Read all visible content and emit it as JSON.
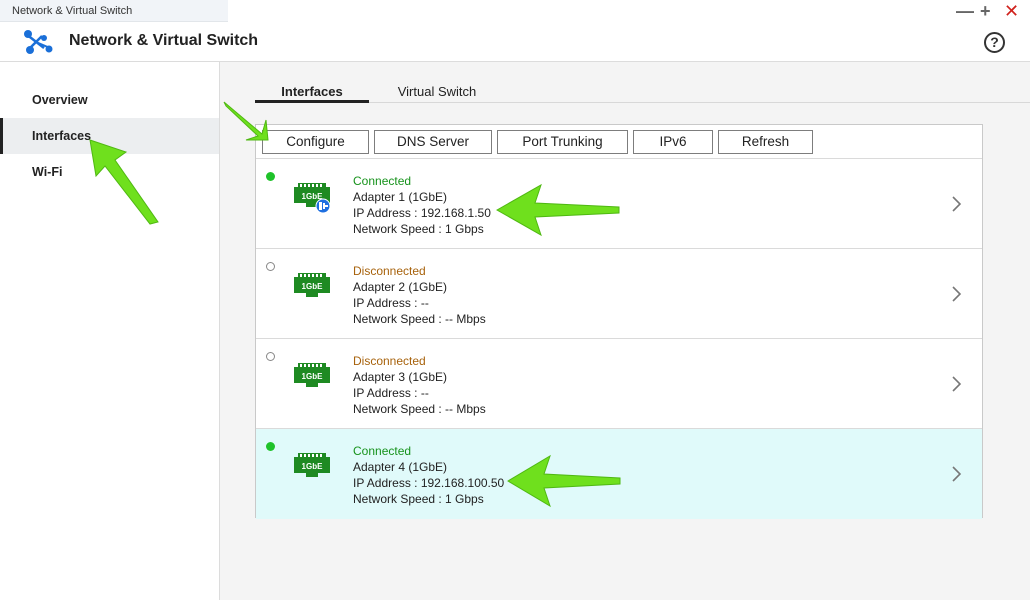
{
  "window": {
    "tab_title": "Network & Virtual Switch",
    "minimize": "—",
    "maximize": "+",
    "close": "✕"
  },
  "header": {
    "title": "Network & Virtual Switch",
    "help": "?"
  },
  "sidebar": {
    "items": [
      {
        "label": "Overview"
      },
      {
        "label": "Interfaces"
      },
      {
        "label": "Wi-Fi"
      }
    ]
  },
  "tabs": [
    {
      "label": "Interfaces"
    },
    {
      "label": "Virtual Switch"
    }
  ],
  "toolbar": {
    "configure": "Configure",
    "dns_server": "DNS Server",
    "port_trunking": "Port Trunking",
    "ipv6": "IPv6",
    "refresh": "Refresh"
  },
  "adapters": [
    {
      "status": "Connected",
      "name": "Adapter 1 (1GbE)",
      "ip": "IP Address : 192.168.1.50",
      "speed": "Network Speed : 1 Gbps",
      "badge": "1GbE"
    },
    {
      "status": "Disconnected",
      "name": "Adapter 2 (1GbE)",
      "ip": "IP Address : --",
      "speed": "Network Speed : -- Mbps",
      "badge": "1GbE"
    },
    {
      "status": "Disconnected",
      "name": "Adapter 3 (1GbE)",
      "ip": "IP Address : --",
      "speed": "Network Speed : -- Mbps",
      "badge": "1GbE"
    },
    {
      "status": "Connected",
      "name": "Adapter 4 (1GbE)",
      "ip": "IP Address : 192.168.100.50",
      "speed": "Network Speed : 1 Gbps",
      "badge": "1GbE"
    }
  ],
  "colors": {
    "connected": "#16921b",
    "disconnected": "#a7620c",
    "port_green": "#1e8a22",
    "selected_row": "#e0fafa",
    "annotation_arrow": "#6fe01d"
  }
}
